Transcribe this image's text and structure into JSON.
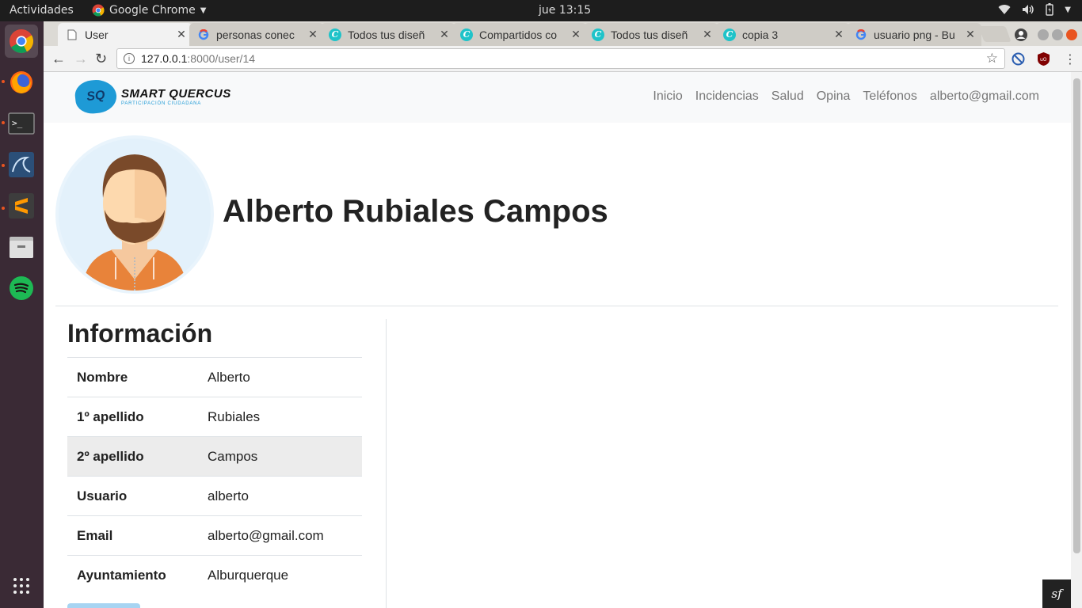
{
  "system": {
    "activities": "Actividades",
    "app_name": "Google Chrome",
    "clock": "jue 13:15"
  },
  "browser": {
    "tabs": [
      {
        "label": "User",
        "icon": "page-icon"
      },
      {
        "label": "personas conec",
        "icon": "google-icon"
      },
      {
        "label": "Todos tus diseñ",
        "icon": "canva-icon"
      },
      {
        "label": "Compartidos co",
        "icon": "canva-icon"
      },
      {
        "label": "Todos tus diseñ",
        "icon": "canva-icon"
      },
      {
        "label": "copia 3",
        "icon": "canva-icon"
      },
      {
        "label": "usuario png - Bu",
        "icon": "google-icon"
      }
    ],
    "url_host": "127.0.0.1",
    "url_path": ":8000/user/14"
  },
  "site": {
    "logo_initials": "SQ",
    "logo_title": "SMART QUERCUS",
    "logo_subtitle": "PARTICIPACIÓN CIUDADANA",
    "nav": [
      "Inicio",
      "Incidencias",
      "Salud",
      "Opina",
      "Teléfonos",
      "alberto@gmail.com"
    ]
  },
  "user": {
    "full_name": "Alberto Rubiales Campos",
    "info_title": "Información",
    "fields": [
      {
        "key": "Nombre",
        "value": "Alberto"
      },
      {
        "key": "1º apellido",
        "value": "Rubiales"
      },
      {
        "key": "2º apellido",
        "value": "Campos"
      },
      {
        "key": "Usuario",
        "value": "alberto"
      },
      {
        "key": "Email",
        "value": "alberto@gmail.com"
      },
      {
        "key": "Ayuntamiento",
        "value": "Alburquerque"
      }
    ]
  },
  "debug": {
    "badge": "sf"
  }
}
